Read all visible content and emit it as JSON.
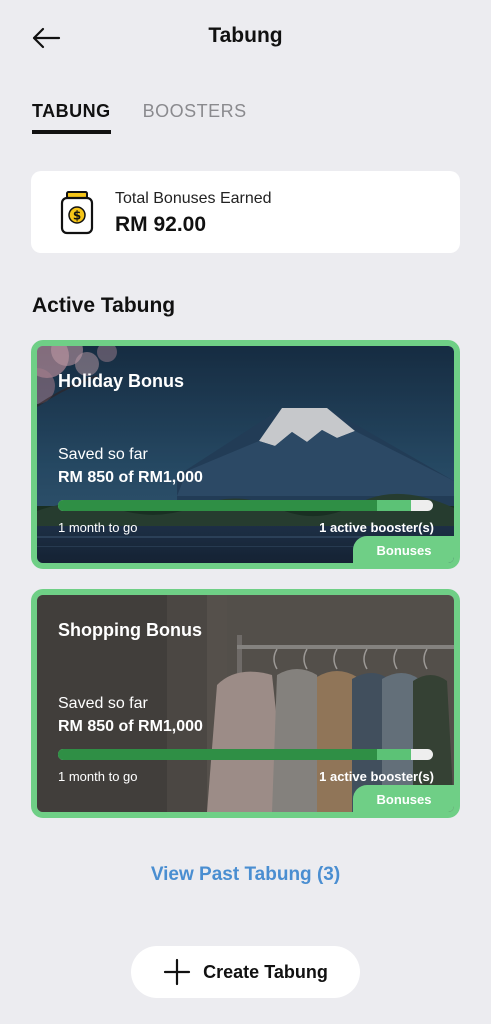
{
  "header": {
    "title": "Tabung",
    "back_icon": "arrow-left-icon"
  },
  "tabs": [
    {
      "label": "TABUNG",
      "active": true
    },
    {
      "label": "BOOSTERS",
      "active": false
    }
  ],
  "summary": {
    "icon": "coin-jar-icon",
    "label": "Total Bonuses Earned",
    "value": "RM 92.00"
  },
  "active_section": {
    "title": "Active Tabung"
  },
  "cards": [
    {
      "title": "Holiday Bonus",
      "image": "mount-fuji-photo",
      "saved_label": "Saved so far",
      "saved_amount": "RM 850 of RM1,000",
      "progress_fraction": 0.85,
      "booster_fraction": 0.09,
      "time_left": "1 month to go",
      "boosters": "1 active booster(s)",
      "tag": "Bonuses"
    },
    {
      "title": "Shopping Bonus",
      "image": "clothing-rack-photo",
      "saved_label": "Saved so far",
      "saved_amount": "RM 850 of RM1,000",
      "progress_fraction": 0.85,
      "booster_fraction": 0.09,
      "time_left": "1 month to go",
      "boosters": "1 active booster(s)",
      "tag": "Bonuses"
    }
  ],
  "past_link": "View Past Tabung (3)",
  "create_button": {
    "label": "Create Tabung",
    "icon": "plus-icon"
  },
  "colors": {
    "accent_green": "#6fcf86",
    "progress_dark": "#2f8f45",
    "link_blue": "#4a8ed1",
    "background": "#ececf0"
  }
}
